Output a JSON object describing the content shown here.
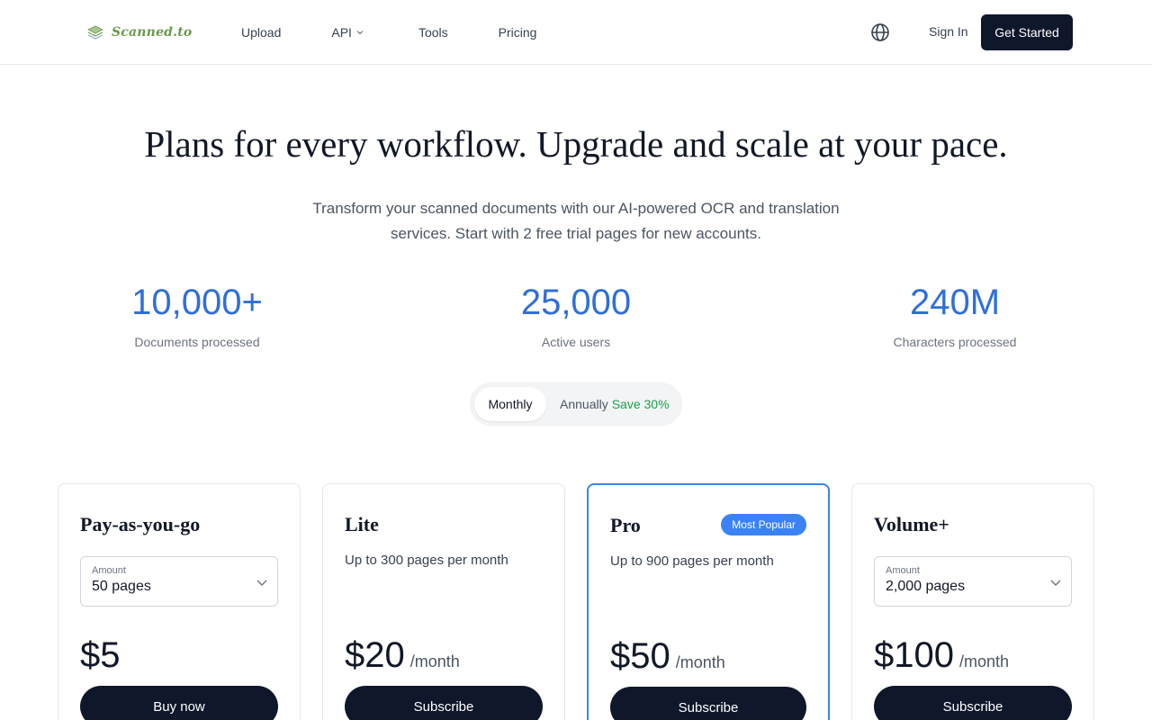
{
  "header": {
    "logo_text": "Scanned.to",
    "nav": [
      {
        "label": "Upload"
      },
      {
        "label": "API"
      },
      {
        "label": "Tools"
      },
      {
        "label": "Pricing"
      }
    ],
    "globe_icon": "globe-icon",
    "sign_in": "Sign In",
    "get_started": "Get Started"
  },
  "hero": {
    "title": "Plans for every workflow. Upgrade and scale at your pace.",
    "subtitle": "Transform your scanned documents with our AI-powered OCR and translation services. Start with 2 free trial pages for new accounts."
  },
  "stats": [
    {
      "value": "10,000+",
      "label": "Documents processed"
    },
    {
      "value": "25,000",
      "label": "Active users"
    },
    {
      "value": "240M",
      "label": "Characters processed"
    }
  ],
  "billing_toggle": {
    "monthly": "Monthly",
    "annually": "Annually",
    "save": "Save 30%",
    "selected": "Monthly"
  },
  "plans": [
    {
      "name": "Pay-as-you-go",
      "amount_label": "Amount",
      "amount_value": "50 pages",
      "price": "$5",
      "button": "Buy now"
    },
    {
      "name": "Lite",
      "description": "Up to 300 pages per month",
      "price": "$20",
      "period": "/month",
      "button": "Subscribe"
    },
    {
      "name": "Pro",
      "badge": "Most Popular",
      "description": "Up to 900 pages per month",
      "price": "$50",
      "period": "/month",
      "button": "Subscribe"
    },
    {
      "name": "Volume+",
      "amount_label": "Amount",
      "amount_value": "2,000 pages",
      "price": "$100",
      "period": "/month",
      "button": "Subscribe"
    }
  ],
  "colors": {
    "accent_blue": "#2f6fd8",
    "primary_dark": "#0f172a",
    "save_green": "#16a34a",
    "popular_badge": "#3b82f6"
  }
}
